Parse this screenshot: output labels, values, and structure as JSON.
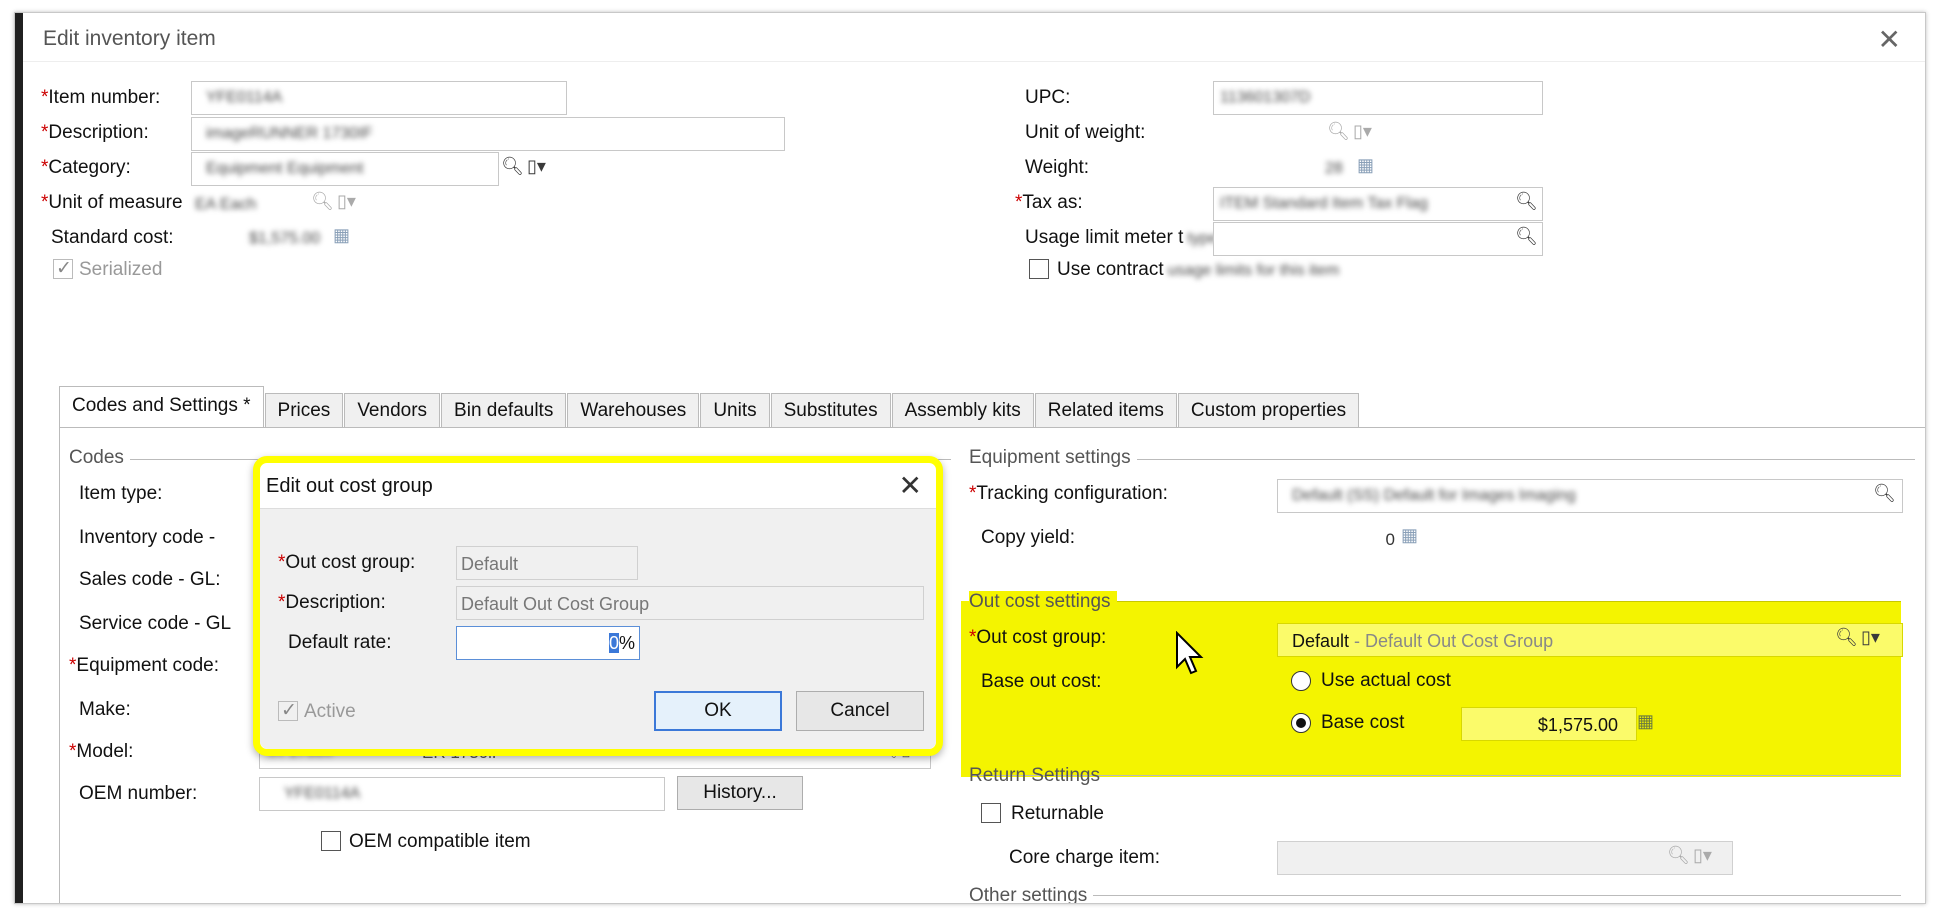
{
  "window": {
    "title": "Edit inventory item",
    "close_icon": "✕"
  },
  "header": {
    "item_number_label": "Item number:",
    "description_label": "Description:",
    "category_label": "Category:",
    "unit_of_measure_label": "Unit of measure",
    "standard_cost_label": "Standard cost:",
    "serialized_label": "Serialized",
    "upc_label": "UPC:",
    "unit_of_weight_label": "Unit of weight:",
    "weight_label": "Weight:",
    "tax_as_label": "Tax as:",
    "usage_limit_label": "Usage limit meter t",
    "use_contract_label": "Use contract",
    "blurred": {
      "item_number": "YFE0114A",
      "description": "imageRUNNER 1730IF",
      "category": "Equipment  Equipment",
      "uom": "EA  Each",
      "standard_cost": "$1,575.00",
      "upc": "113601307D",
      "weight": "28",
      "tax_as": "ITEM   Standard Item Tax Flag",
      "usage_limit_tail": "type",
      "use_contract_tail": "usage limits for this item"
    }
  },
  "tabs": [
    {
      "label": "Codes and Settings  *",
      "active": true
    },
    {
      "label": "Prices"
    },
    {
      "label": "Vendors"
    },
    {
      "label": "Bin defaults"
    },
    {
      "label": "Warehouses"
    },
    {
      "label": "Units"
    },
    {
      "label": "Substitutes"
    },
    {
      "label": "Assembly kits"
    },
    {
      "label": "Related items"
    },
    {
      "label": "Custom properties"
    }
  ],
  "codes": {
    "section_title": "Codes",
    "item_type_label": "Item type:",
    "inventory_code_label": "Inventory code -",
    "sales_code_label": "Sales code - GL:",
    "service_code_label": "Service code - GL",
    "equipment_code_label": "Equipment code:",
    "make_label": "Make:",
    "model_label": "Model:",
    "oem_number_label": "OEM number:",
    "model_value_tail": "ER 1730iF",
    "history_button": "History...",
    "oem_compatible_label": "OEM compatible item",
    "blurred_model": "IR 1730IF",
    "blurred_oem": "YFE0114A"
  },
  "equipment": {
    "section_title": "Equipment settings",
    "tracking_label": "Tracking configuration:",
    "copy_yield_label": "Copy yield:",
    "copy_yield_value": "0",
    "blurred_tracking": "Default (SS)   Default for Images Imaging"
  },
  "out_cost": {
    "section_title": "Out cost settings",
    "group_label": "Out cost group:",
    "group_value": "Default",
    "group_desc": " - Default Out Cost Group",
    "base_label": "Base out cost:",
    "use_actual_label": "Use actual cost",
    "base_cost_label": "Base cost",
    "base_cost_value": "$1,575.00"
  },
  "return_settings": {
    "section_title": "Return Settings",
    "returnable_label": "Returnable",
    "core_charge_label": "Core charge item:"
  },
  "other_settings": {
    "section_title": "Other settings"
  },
  "dialog": {
    "title": "Edit out cost group",
    "close_icon": "✕",
    "group_label": "Out cost group:",
    "group_value": "Default",
    "description_label": "Description:",
    "description_value": "Default Out Cost Group",
    "rate_label": "Default rate:",
    "rate_value": "0",
    "rate_unit": "%",
    "active_label": "Active",
    "ok_button": "OK",
    "cancel_button": "Cancel"
  },
  "icons": {
    "search": "search-icon",
    "dropdown": "dropdown-icon",
    "calculator": "calculator-icon"
  },
  "colors": {
    "highlight": "#f4f400",
    "required": "#cc0000"
  }
}
